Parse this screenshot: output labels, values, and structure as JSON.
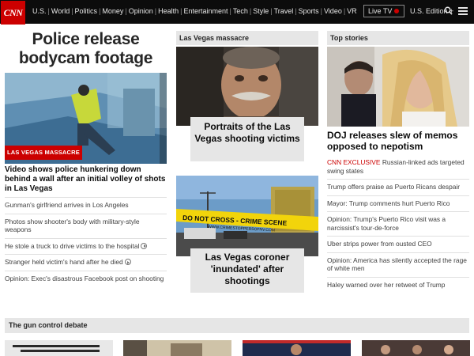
{
  "brand": {
    "logo_text": "CNN"
  },
  "nav": {
    "items": [
      "U.S.",
      "World",
      "Politics",
      "Money",
      "Opinion",
      "Health",
      "Entertainment",
      "Tech",
      "Style",
      "Travel",
      "Sports",
      "Video",
      "VR"
    ],
    "live_tv": "Live TV",
    "edition": "U.S. Edition +",
    "icons": [
      "search-icon",
      "menu-icon"
    ]
  },
  "colors": {
    "brand_red": "#cc0000",
    "nav_bg": "#0c0c0c",
    "section_bg": "#e6e6e6"
  },
  "col1": {
    "title": "Police release bodycam footage",
    "tag": "LAS VEGAS MASSACRE",
    "headline": "Video shows police hunkering down behind a wall after an initial volley of shots in Las Vegas",
    "items": [
      {
        "text": "Gunman's girlfriend arrives in Los Angeles",
        "video": false
      },
      {
        "text": "Photos show shooter's body with military-style weapons",
        "video": false
      },
      {
        "text": "He stole a truck to drive victims to the hospital",
        "video": true
      },
      {
        "text": "Stranger held victim's hand after he died",
        "video": true
      },
      {
        "text": "Opinion: Exec's disastrous Facebook post on shooting",
        "video": false
      }
    ]
  },
  "col2": {
    "section": "Las Vegas massacre",
    "headline1": "Portraits of the Las Vegas shooting victims",
    "headline2": "Las Vegas coroner 'inundated' after shootings",
    "tape_text": "DO NOT CROSS - CRIME SCENE",
    "tape_url": "WWW.CRIMESTOPPERSOFNV.COM"
  },
  "col3": {
    "section": "Top stories",
    "headline": "DOJ releases slew of memos opposed to nepotism",
    "exclusive_label": "CNN EXCLUSIVE",
    "exclusive_text": "Russian-linked ads targeted swing states",
    "items": [
      "Trump offers praise as Puerto Ricans despair",
      "Mayor: Trump comments hurt Puerto Rico",
      "Opinion: Trump's Puerto Rico visit was a narcissist's tour-de-force",
      "Uber strips power from ousted CEO",
      "Opinion: America has silently accepted the rage of white men",
      "Haley warned over her retweet of Trump"
    ]
  },
  "bottom": {
    "section": "The gun control debate"
  }
}
